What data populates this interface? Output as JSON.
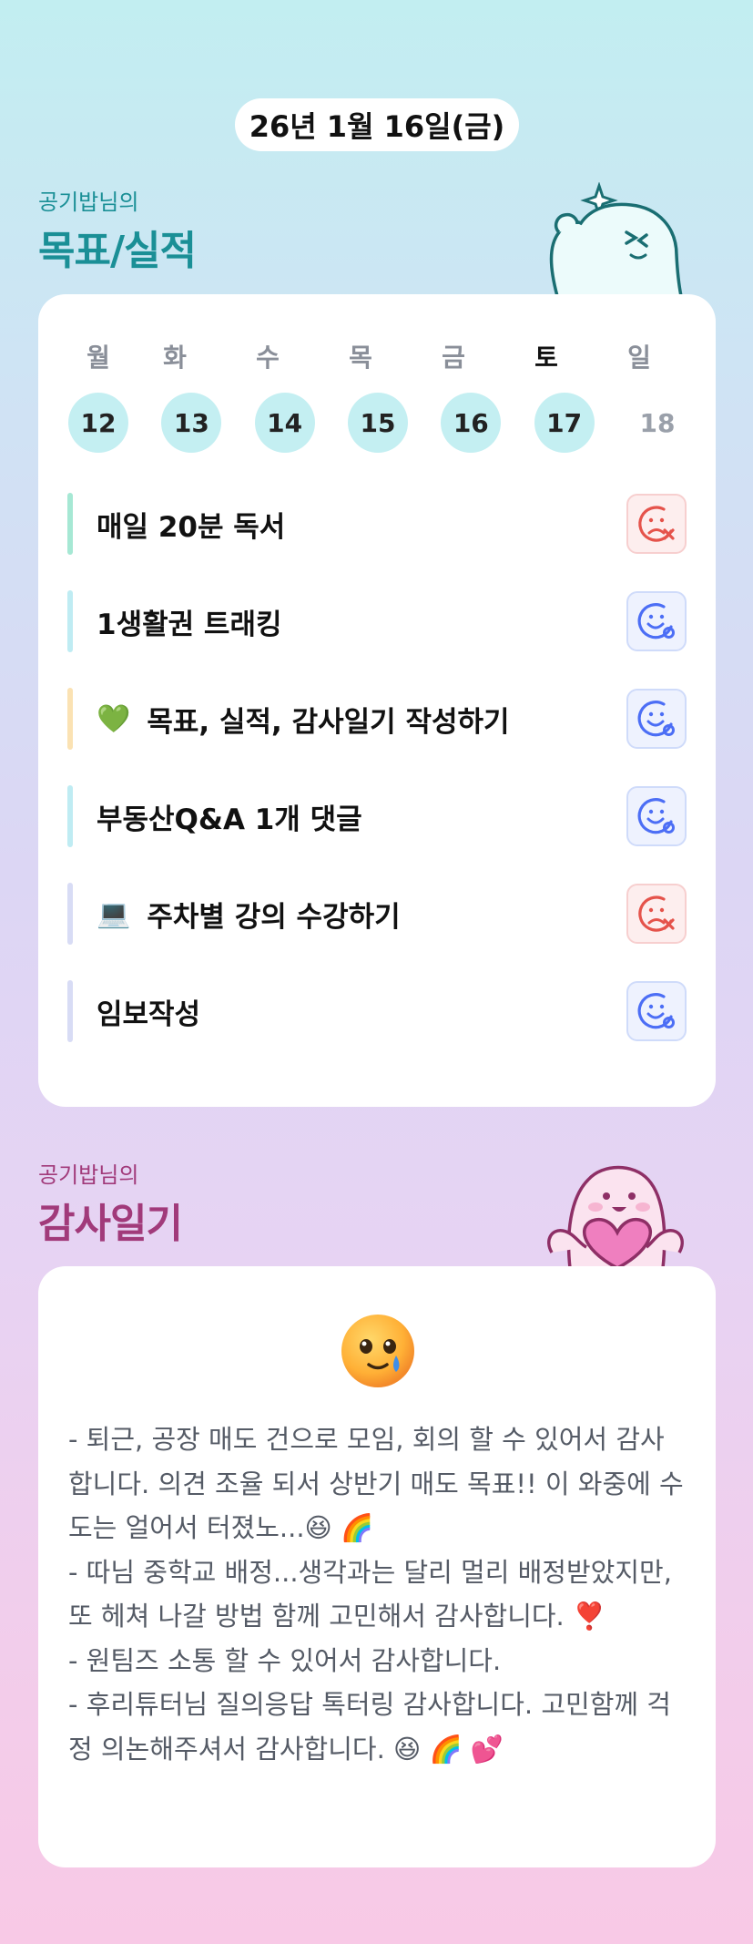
{
  "date": "26년 1월 16일(금)",
  "goals_section": {
    "subtitle": "공기밥님의",
    "title": "목표/실적"
  },
  "gratitude_section": {
    "subtitle": "공기밥님의",
    "title": "감사일기"
  },
  "weekdays": [
    "월",
    "화",
    "수",
    "목",
    "금",
    "토",
    "일"
  ],
  "days": [
    "12",
    "13",
    "14",
    "15",
    "16",
    "17",
    "18"
  ],
  "goals": [
    {
      "emoji": "",
      "label": "매일 20분 독서",
      "status": "fail",
      "bar_color": "#a6e8d4"
    },
    {
      "emoji": "",
      "label": "1생활권 트래킹",
      "status": "ok",
      "bar_color": "#bfecf3"
    },
    {
      "emoji": "💚",
      "label": "목표, 실적, 감사일기 작성하기",
      "status": "ok",
      "bar_color": "#fbe2b3"
    },
    {
      "emoji": "",
      "label": "부동산Q&A 1개 댓글",
      "status": "ok",
      "bar_color": "#bfecf3"
    },
    {
      "emoji": "💻",
      "label": "주차별 강의 수강하기",
      "status": "fail",
      "bar_color": "#d8dcf5"
    },
    {
      "emoji": "",
      "label": "임보작성",
      "status": "ok",
      "bar_color": "#d8dcf5"
    }
  ],
  "gratitude_text": "- 퇴근, 공장 매도 건으로 모임, 회의 할 수 있어서 감사합니다. 의견 조율 되서 상반기 매도 목표!! 이 와중에 수도는 얼어서 터졌노...😆 🌈\n- 따님 중학교 배정...생각과는 달리 멀리 배정받았지만, 또 헤쳐 나갈 방법 함께 고민해서 감사합니다. ❣️\n- 원팀즈 소통 할 수 있어서 감사합니다.\n- 후리튜터님 질의응답 톡터링 감사합니다. 고민함께 걱정 의논해주셔서 감사합니다. 😆 🌈 💕",
  "colors": {
    "fail": "#e5534b",
    "ok": "#4c6ef5",
    "done_day": "#c4eff2"
  }
}
